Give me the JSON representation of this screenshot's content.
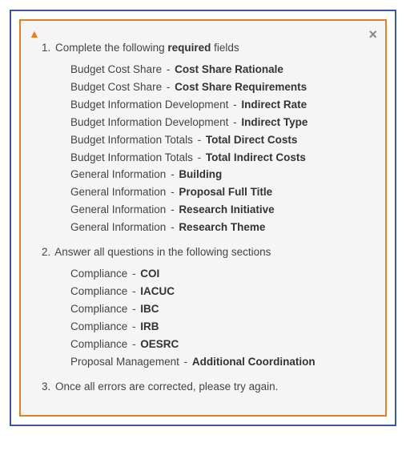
{
  "icons": {
    "warning": "▲",
    "close": "×"
  },
  "sections": [
    {
      "num": "1.",
      "prefix": "Complete the following ",
      "bold": "required",
      "suffix": " fields",
      "items": [
        {
          "category": "Budget Cost Share",
          "field": "Cost Share Rationale"
        },
        {
          "category": "Budget Cost Share",
          "field": "Cost Share Requirements"
        },
        {
          "category": "Budget Information Development",
          "field": "Indirect Rate"
        },
        {
          "category": "Budget Information Development",
          "field": "Indirect Type"
        },
        {
          "category": "Budget Information Totals",
          "field": "Total Direct Costs"
        },
        {
          "category": "Budget Information Totals",
          "field": "Total Indirect Costs"
        },
        {
          "category": "General Information",
          "field": "Building"
        },
        {
          "category": "General Information",
          "field": "Proposal Full Title"
        },
        {
          "category": "General Information",
          "field": "Research Initiative"
        },
        {
          "category": "General Information",
          "field": "Research Theme"
        }
      ]
    },
    {
      "num": "2.",
      "prefix": "Answer all questions in the following sections",
      "bold": "",
      "suffix": "",
      "items": [
        {
          "category": "Compliance",
          "field": "COI"
        },
        {
          "category": "Compliance",
          "field": "IACUC"
        },
        {
          "category": "Compliance",
          "field": "IBC"
        },
        {
          "category": "Compliance",
          "field": "IRB"
        },
        {
          "category": "Compliance",
          "field": "OESRC"
        },
        {
          "category": "Proposal Management",
          "field": "Additional Coordination"
        }
      ]
    },
    {
      "num": "3.",
      "prefix": "Once all errors are corrected, please try again.",
      "bold": "",
      "suffix": "",
      "items": []
    }
  ]
}
